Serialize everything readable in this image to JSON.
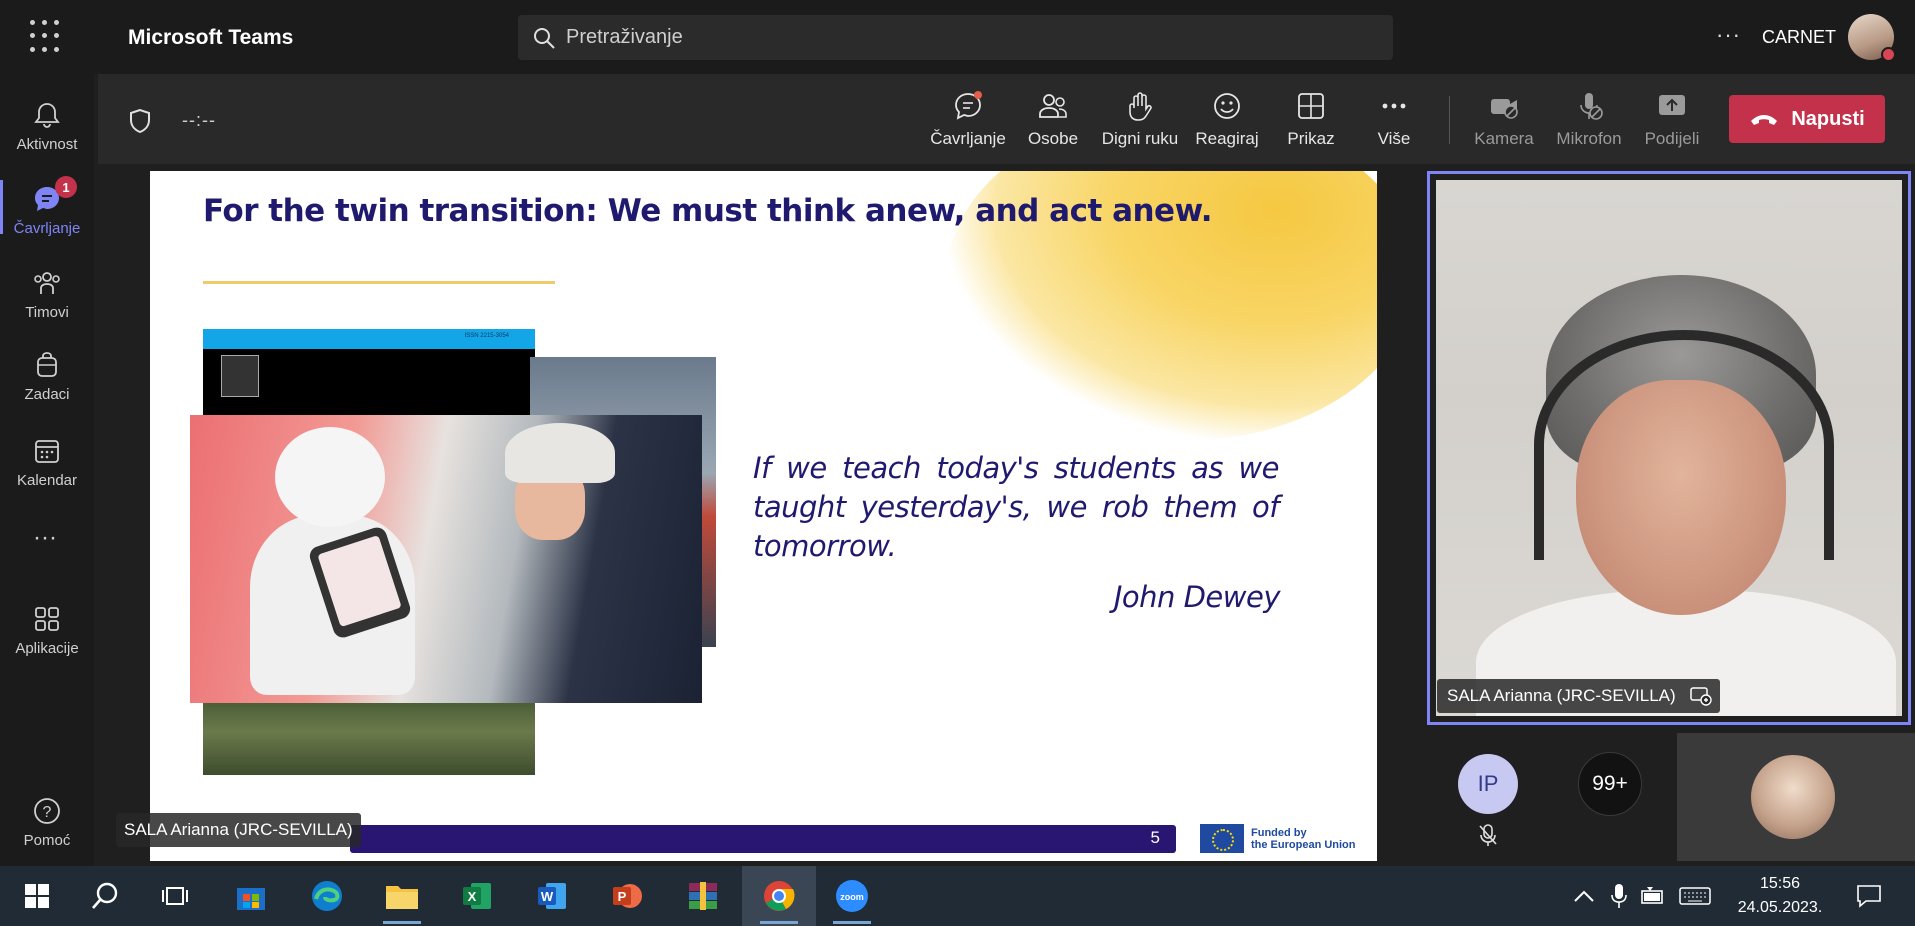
{
  "app": {
    "title": "Microsoft Teams",
    "org": "CARNET"
  },
  "search": {
    "placeholder": "Pretraživanje"
  },
  "rail": {
    "items": [
      {
        "label": "Aktivnost",
        "icon": "bell-icon"
      },
      {
        "label": "Čavrljanje",
        "icon": "chat-icon",
        "badge": "1",
        "active": true
      },
      {
        "label": "Timovi",
        "icon": "teams-icon"
      },
      {
        "label": "Zadaci",
        "icon": "tasks-icon"
      },
      {
        "label": "Kalendar",
        "icon": "calendar-icon"
      },
      {
        "label": "Aplikacije",
        "icon": "apps-icon"
      },
      {
        "label": "Pomoć",
        "icon": "help-icon"
      }
    ]
  },
  "meeting": {
    "timer": "--:--",
    "tools": [
      {
        "label": "Čavrljanje",
        "icon": "chat-icon"
      },
      {
        "label": "Osobe",
        "icon": "people-icon"
      },
      {
        "label": "Digni ruku",
        "icon": "raise-hand-icon"
      },
      {
        "label": "Reagiraj",
        "icon": "smiley-icon"
      },
      {
        "label": "Prikaz",
        "icon": "grid-view-icon"
      },
      {
        "label": "Više",
        "icon": "more-icon"
      },
      {
        "label": "Kamera",
        "icon": "camera-off-icon"
      },
      {
        "label": "Mikrofon",
        "icon": "mic-off-icon"
      },
      {
        "label": "Podijeli",
        "icon": "share-icon"
      }
    ],
    "leave_label": "Napusti"
  },
  "slide": {
    "title": "For the twin transition: We must think anew, and act anew.",
    "quote": "If we teach today's students as we taught yesterday's, we rob them of tomorrow.",
    "author": "John Dewey",
    "page_number": "5",
    "journal_issn": "ISSN 2215-3054",
    "eu_text_line1": "Funded by",
    "eu_text_line2": "the European Union"
  },
  "presenter": {
    "name": "SALA Arianna (JRC-SEVILLA)"
  },
  "participants": {
    "speaker_name": "SALA Arianna (JRC-SEVILLA)",
    "ip_initials": "IP",
    "more_count": "99+"
  },
  "taskbar": {
    "apps": [
      "windows-start-icon",
      "search-icon",
      "task-view-icon",
      "store-icon",
      "edge-icon",
      "file-explorer-icon",
      "excel-icon",
      "word-icon",
      "powerpoint-icon",
      "winrar-icon",
      "chrome-icon",
      "zoom-icon"
    ],
    "time": "15:56",
    "date": "24.05.2023."
  },
  "colors": {
    "accent": "#7f85f5",
    "leave": "#c4314b",
    "slide_text": "#1f1a6e"
  }
}
